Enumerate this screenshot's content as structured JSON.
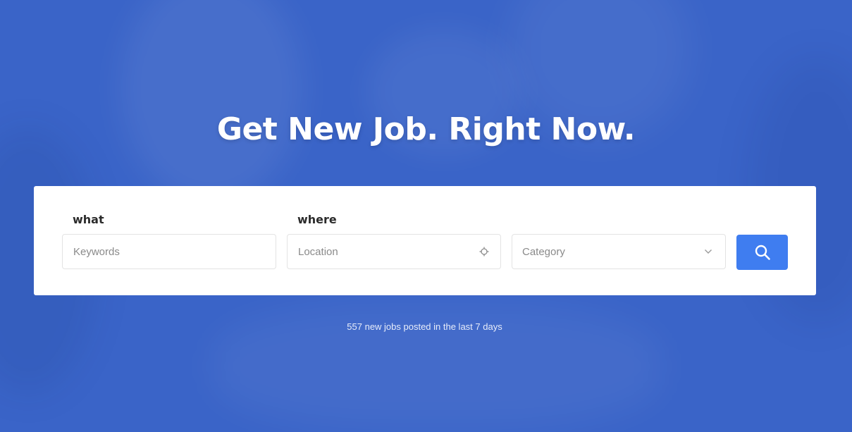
{
  "hero": {
    "title": "Get New Job. Right Now.",
    "background_color": "#3a64c8"
  },
  "search": {
    "what_label": "what",
    "where_label": "where",
    "keywords_placeholder": "Keywords",
    "keywords_value": "",
    "location_placeholder": "Location",
    "location_value": "",
    "location_icon": "crosshair-icon",
    "category_selected": "Category",
    "category_icon": "chevron-down-icon",
    "submit_icon": "search-icon",
    "submit_color": "#3f7df0"
  },
  "stats": {
    "text": "557 new jobs posted in the last 7 days"
  }
}
